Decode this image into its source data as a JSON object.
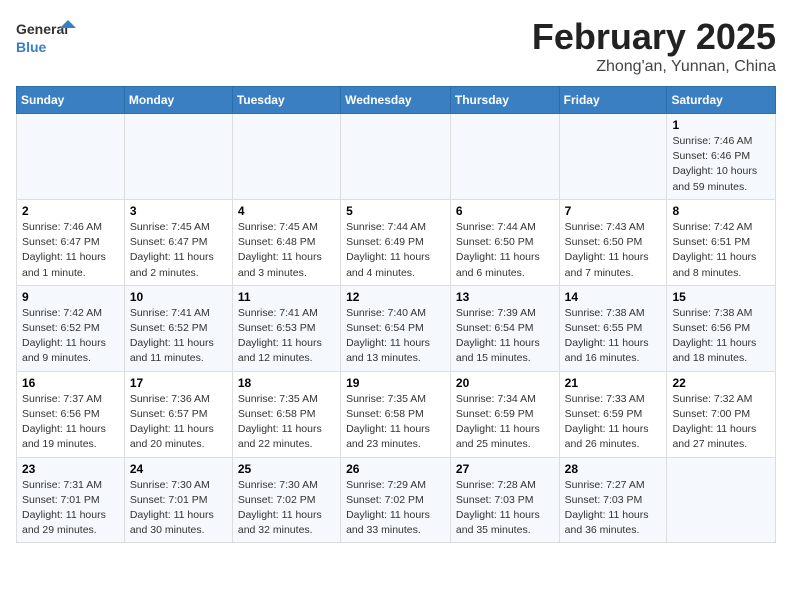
{
  "header": {
    "logo_general": "General",
    "logo_blue": "Blue",
    "main_title": "February 2025",
    "sub_title": "Zhong'an, Yunnan, China"
  },
  "weekdays": [
    "Sunday",
    "Monday",
    "Tuesday",
    "Wednesday",
    "Thursday",
    "Friday",
    "Saturday"
  ],
  "weeks": [
    [
      {
        "day": "",
        "details": ""
      },
      {
        "day": "",
        "details": ""
      },
      {
        "day": "",
        "details": ""
      },
      {
        "day": "",
        "details": ""
      },
      {
        "day": "",
        "details": ""
      },
      {
        "day": "",
        "details": ""
      },
      {
        "day": "1",
        "details": "Sunrise: 7:46 AM\nSunset: 6:46 PM\nDaylight: 10 hours\nand 59 minutes."
      }
    ],
    [
      {
        "day": "2",
        "details": "Sunrise: 7:46 AM\nSunset: 6:47 PM\nDaylight: 11 hours\nand 1 minute."
      },
      {
        "day": "3",
        "details": "Sunrise: 7:45 AM\nSunset: 6:47 PM\nDaylight: 11 hours\nand 2 minutes."
      },
      {
        "day": "4",
        "details": "Sunrise: 7:45 AM\nSunset: 6:48 PM\nDaylight: 11 hours\nand 3 minutes."
      },
      {
        "day": "5",
        "details": "Sunrise: 7:44 AM\nSunset: 6:49 PM\nDaylight: 11 hours\nand 4 minutes."
      },
      {
        "day": "6",
        "details": "Sunrise: 7:44 AM\nSunset: 6:50 PM\nDaylight: 11 hours\nand 6 minutes."
      },
      {
        "day": "7",
        "details": "Sunrise: 7:43 AM\nSunset: 6:50 PM\nDaylight: 11 hours\nand 7 minutes."
      },
      {
        "day": "8",
        "details": "Sunrise: 7:42 AM\nSunset: 6:51 PM\nDaylight: 11 hours\nand 8 minutes."
      }
    ],
    [
      {
        "day": "9",
        "details": "Sunrise: 7:42 AM\nSunset: 6:52 PM\nDaylight: 11 hours\nand 9 minutes."
      },
      {
        "day": "10",
        "details": "Sunrise: 7:41 AM\nSunset: 6:52 PM\nDaylight: 11 hours\nand 11 minutes."
      },
      {
        "day": "11",
        "details": "Sunrise: 7:41 AM\nSunset: 6:53 PM\nDaylight: 11 hours\nand 12 minutes."
      },
      {
        "day": "12",
        "details": "Sunrise: 7:40 AM\nSunset: 6:54 PM\nDaylight: 11 hours\nand 13 minutes."
      },
      {
        "day": "13",
        "details": "Sunrise: 7:39 AM\nSunset: 6:54 PM\nDaylight: 11 hours\nand 15 minutes."
      },
      {
        "day": "14",
        "details": "Sunrise: 7:38 AM\nSunset: 6:55 PM\nDaylight: 11 hours\nand 16 minutes."
      },
      {
        "day": "15",
        "details": "Sunrise: 7:38 AM\nSunset: 6:56 PM\nDaylight: 11 hours\nand 18 minutes."
      }
    ],
    [
      {
        "day": "16",
        "details": "Sunrise: 7:37 AM\nSunset: 6:56 PM\nDaylight: 11 hours\nand 19 minutes."
      },
      {
        "day": "17",
        "details": "Sunrise: 7:36 AM\nSunset: 6:57 PM\nDaylight: 11 hours\nand 20 minutes."
      },
      {
        "day": "18",
        "details": "Sunrise: 7:35 AM\nSunset: 6:58 PM\nDaylight: 11 hours\nand 22 minutes."
      },
      {
        "day": "19",
        "details": "Sunrise: 7:35 AM\nSunset: 6:58 PM\nDaylight: 11 hours\nand 23 minutes."
      },
      {
        "day": "20",
        "details": "Sunrise: 7:34 AM\nSunset: 6:59 PM\nDaylight: 11 hours\nand 25 minutes."
      },
      {
        "day": "21",
        "details": "Sunrise: 7:33 AM\nSunset: 6:59 PM\nDaylight: 11 hours\nand 26 minutes."
      },
      {
        "day": "22",
        "details": "Sunrise: 7:32 AM\nSunset: 7:00 PM\nDaylight: 11 hours\nand 27 minutes."
      }
    ],
    [
      {
        "day": "23",
        "details": "Sunrise: 7:31 AM\nSunset: 7:01 PM\nDaylight: 11 hours\nand 29 minutes."
      },
      {
        "day": "24",
        "details": "Sunrise: 7:30 AM\nSunset: 7:01 PM\nDaylight: 11 hours\nand 30 minutes."
      },
      {
        "day": "25",
        "details": "Sunrise: 7:30 AM\nSunset: 7:02 PM\nDaylight: 11 hours\nand 32 minutes."
      },
      {
        "day": "26",
        "details": "Sunrise: 7:29 AM\nSunset: 7:02 PM\nDaylight: 11 hours\nand 33 minutes."
      },
      {
        "day": "27",
        "details": "Sunrise: 7:28 AM\nSunset: 7:03 PM\nDaylight: 11 hours\nand 35 minutes."
      },
      {
        "day": "28",
        "details": "Sunrise: 7:27 AM\nSunset: 7:03 PM\nDaylight: 11 hours\nand 36 minutes."
      },
      {
        "day": "",
        "details": ""
      }
    ]
  ]
}
